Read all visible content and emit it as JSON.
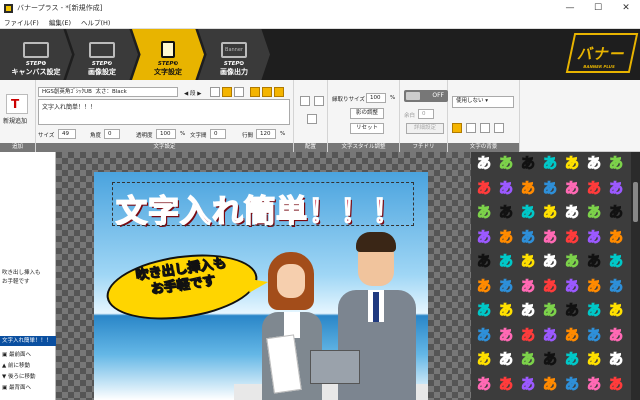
{
  "window": {
    "title": "バナープラス - *[新規作成]",
    "controls": [
      "—",
      "☐",
      "✕"
    ]
  },
  "menu": [
    "ファイル(F)",
    "編集(E)",
    "ヘルプ(H)"
  ],
  "steps": [
    {
      "num": "STEP❶",
      "label": "キャンバス設定",
      "icon": "canvas-icon"
    },
    {
      "num": "STEP❷",
      "label": "画像設定",
      "icon": "image-icon"
    },
    {
      "num": "STEP❸",
      "label": "文字設定",
      "icon": "text-icon",
      "active": true
    },
    {
      "num": "STEP❹",
      "label": "画像出力",
      "icon": "banner-icon",
      "sublabel": "Banner"
    }
  ],
  "logo": {
    "text": "バナー",
    "sub": "BANNER PLUS"
  },
  "ribbon": {
    "add": {
      "label": "新規追加",
      "group": "追加"
    },
    "text_settings": {
      "font": "HGS創英角ｺﾞｼｯｸUB",
      "style": "太さ：Black",
      "nav_label": "段",
      "textarea": "文字入れ簡単！！！",
      "size_label": "サイズ",
      "size_value": "49",
      "angle_label": "角度",
      "angle_value": "0",
      "opacity_label": "透明度",
      "opacity_value": "100",
      "spacing_label": "文字間",
      "spacing_value": "0",
      "line_label": "行間",
      "line_value": "120",
      "percent": "%",
      "group": "文字設定"
    },
    "align": {
      "group": "配置"
    },
    "style_adjust": {
      "ratio_label": "縁取りサイズ",
      "ratio_value": "100",
      "percent": "%",
      "color_btn": "影の調整",
      "reset_btn": "リセット",
      "group": "文字スタイル調整"
    },
    "fuchidori": {
      "toggle": "OFF",
      "margin_label": "余白",
      "margin_value": "0",
      "detail_btn": "詳細設定",
      "group": "フチドリ"
    },
    "background": {
      "select": "使用しない",
      "group": "文字の背景"
    }
  },
  "sidebar": {
    "items": [
      "吹き出し挿入も",
      "お手軽です"
    ],
    "selected": "文字入れ簡単！！！",
    "actions": [
      "最前面へ",
      "前に移動",
      "後ろに移動",
      "最背面へ"
    ]
  },
  "canvas": {
    "headline": "文字入れ簡単！！！",
    "bubble_lines": [
      "吹き出し挿入も",
      "お手軽です"
    ]
  },
  "styles_panel": {
    "glyph": "あ",
    "colors": [
      "#2e8fd8",
      "#ffe000",
      "#ff69b4",
      "#ffffff",
      "#ff3b3b",
      "#7cd24a",
      "#9b59ff",
      "#111111",
      "#ff8a00",
      "#00c8c8"
    ]
  }
}
